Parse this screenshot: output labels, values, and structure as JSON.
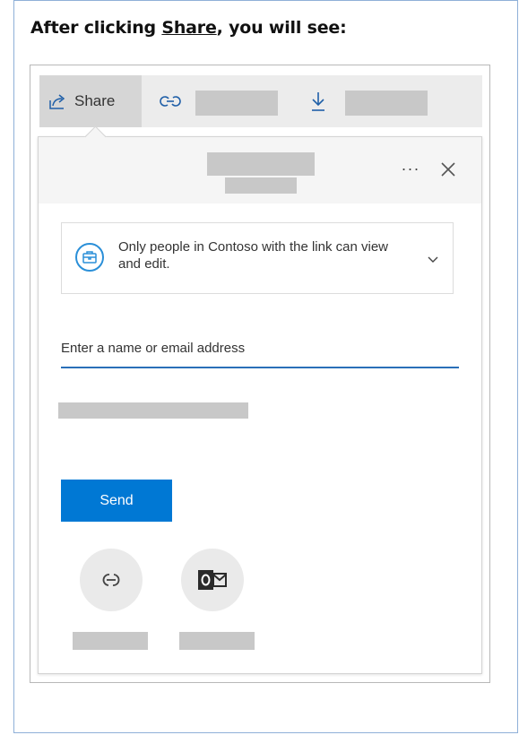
{
  "heading": {
    "prefix": "After clicking ",
    "link": "Share",
    "suffix": ", you will see:"
  },
  "toolbar": {
    "share_label": "Share",
    "share_icon": "share-icon",
    "link_icon": "link-icon",
    "download_icon": "download-icon"
  },
  "dialog": {
    "more_label": "···",
    "permission_text": "Only people in Contoso with the link can view and edit.",
    "permission_icon": "briefcase-icon",
    "email_placeholder": "Enter a name or email address",
    "send_label": "Send",
    "share_options": [
      "copy-link-icon",
      "outlook-icon"
    ]
  },
  "colors": {
    "accent": "#0078d4",
    "permission_icon": "#2a8fd8",
    "placeholder_gray": "#c8c8c8"
  }
}
